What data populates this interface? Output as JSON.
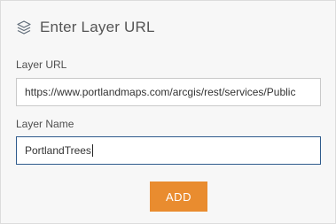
{
  "dialog": {
    "title": "Enter Layer URL",
    "title_icon": "layers-icon"
  },
  "layer_url": {
    "label": "Layer URL",
    "value": "https://www.portlandmaps.com/arcgis/rest/services/Public"
  },
  "layer_name": {
    "label": "Layer Name",
    "value": "PortlandTrees"
  },
  "actions": {
    "add_label": "ADD"
  },
  "colors": {
    "accent": "#e98c2f",
    "focus_border": "#2f5b8c",
    "panel_bg": "#f7f7f7"
  }
}
